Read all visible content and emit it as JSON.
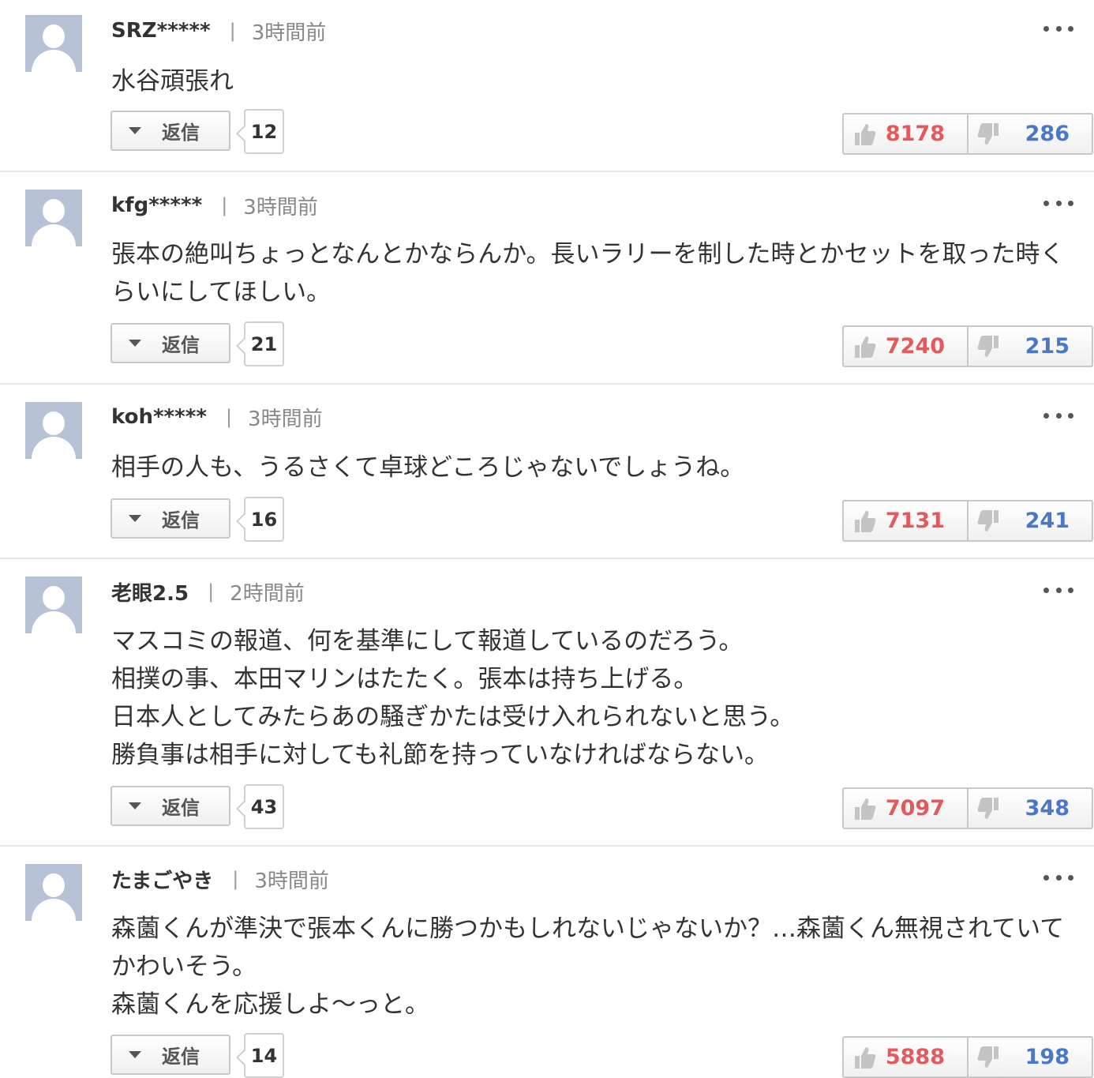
{
  "comments": [
    {
      "user": "SRZ*****",
      "time": "3時間前",
      "text": "水谷頑張れ",
      "reply_label": "返信",
      "reply_count": "12",
      "likes": "8178",
      "dislikes": "286"
    },
    {
      "user": "kfg*****",
      "time": "3時間前",
      "text": "張本の絶叫ちょっとなんとかならんか。長いラリーを制した時とかセットを取った時くらいにしてほしい。",
      "reply_label": "返信",
      "reply_count": "21",
      "likes": "7240",
      "dislikes": "215"
    },
    {
      "user": "koh*****",
      "time": "3時間前",
      "text": "相手の人も、うるさくて卓球どころじゃないでしょうね。",
      "reply_label": "返信",
      "reply_count": "16",
      "likes": "7131",
      "dislikes": "241"
    },
    {
      "user": "老眼2.5",
      "time": "2時間前",
      "text": "マスコミの報道、何を基準にして報道しているのだろう。\n相撲の事、本田マリンはたたく。張本は持ち上げる。\n日本人としてみたらあの騒ぎかたは受け入れられないと思う。\n勝負事は相手に対しても礼節を持っていなければならない。",
      "reply_label": "返信",
      "reply_count": "43",
      "likes": "7097",
      "dislikes": "348"
    },
    {
      "user": "たまごやき",
      "time": "3時間前",
      "text": "森薗くんが準決で張本くんに勝つかもしれないじゃないか？…森薗くん無視されていてかわいそう。\n森薗くんを応援しよ〜っと。",
      "reply_label": "返信",
      "reply_count": "14",
      "likes": "5888",
      "dislikes": "198"
    }
  ],
  "meta_separator": "|",
  "icons": {
    "avatar": "default-user-avatar",
    "more": "more-dots-icon",
    "reply_toggle": "triangle-down-icon",
    "like": "thumbs-up-icon",
    "dislike": "thumbs-down-icon"
  },
  "colors": {
    "like": "#e5595d",
    "dislike": "#4a78c8",
    "avatar_bg": "#b7c2d6"
  }
}
